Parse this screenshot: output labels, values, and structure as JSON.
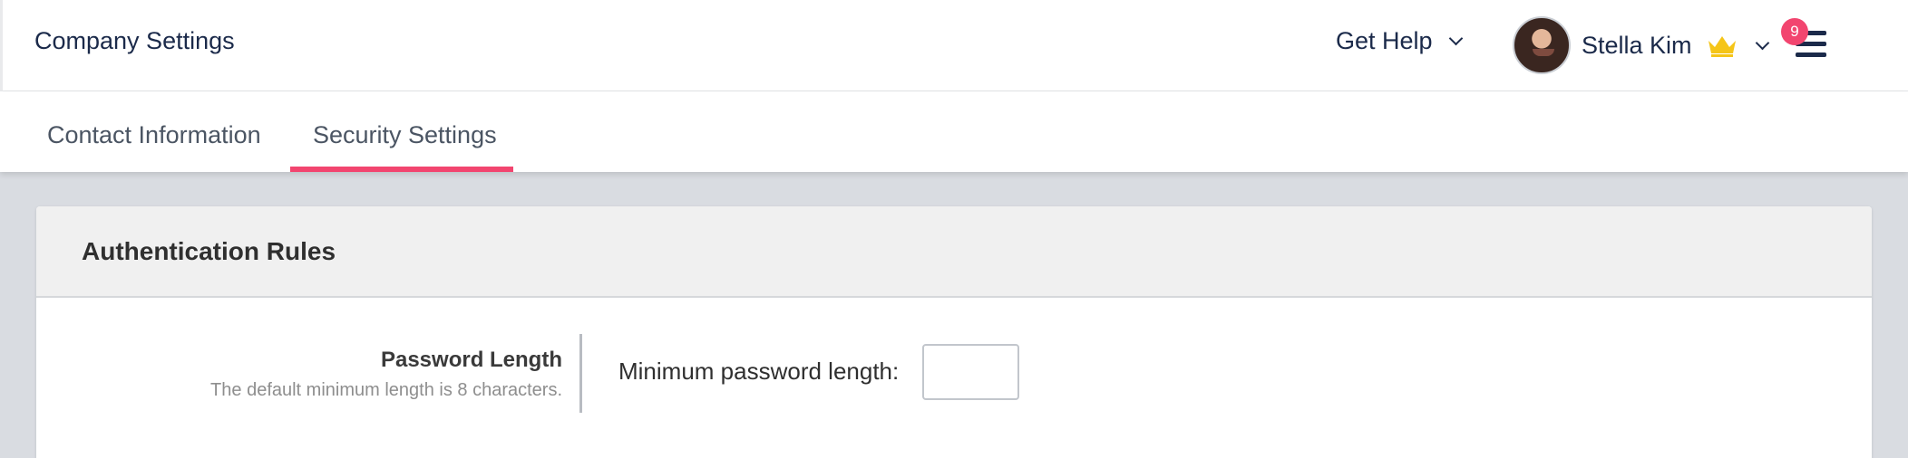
{
  "header": {
    "title": "Company Settings",
    "get_help_label": "Get Help",
    "user": {
      "name": "Stella Kim",
      "avatar_icon": "user-avatar",
      "crown_icon": "crown-icon"
    },
    "notifications": {
      "count": "9"
    },
    "menu_icon": "hamburger-menu-icon"
  },
  "tabs": [
    {
      "label": "Contact Information",
      "active": false
    },
    {
      "label": "Security Settings",
      "active": true
    }
  ],
  "section": {
    "title": "Authentication Rules",
    "password": {
      "label": "Password Length",
      "description": "The default minimum length is 8 characters.",
      "field_label": "Minimum password length:",
      "value": ""
    }
  },
  "colors": {
    "accent": "#f2456f",
    "navy": "#1b2a4a",
    "crown": "#f5c518",
    "page_bg": "#d9dce1"
  }
}
